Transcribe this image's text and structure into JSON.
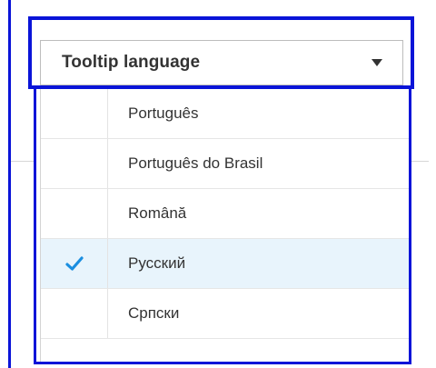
{
  "dropdown": {
    "label": "Tooltip language"
  },
  "menu": {
    "items": [
      {
        "label": "Português",
        "selected": false
      },
      {
        "label": "Português do Brasil",
        "selected": false
      },
      {
        "label": "Română",
        "selected": false
      },
      {
        "label": "Русский",
        "selected": true
      },
      {
        "label": "Српски",
        "selected": false
      }
    ]
  },
  "colors": {
    "highlight_border": "#0a14d8",
    "check": "#1a8ee0",
    "selected_row": "#e8f4fc"
  },
  "icons": {
    "caret": "chevron-down-icon",
    "check": "checkmark-icon"
  }
}
